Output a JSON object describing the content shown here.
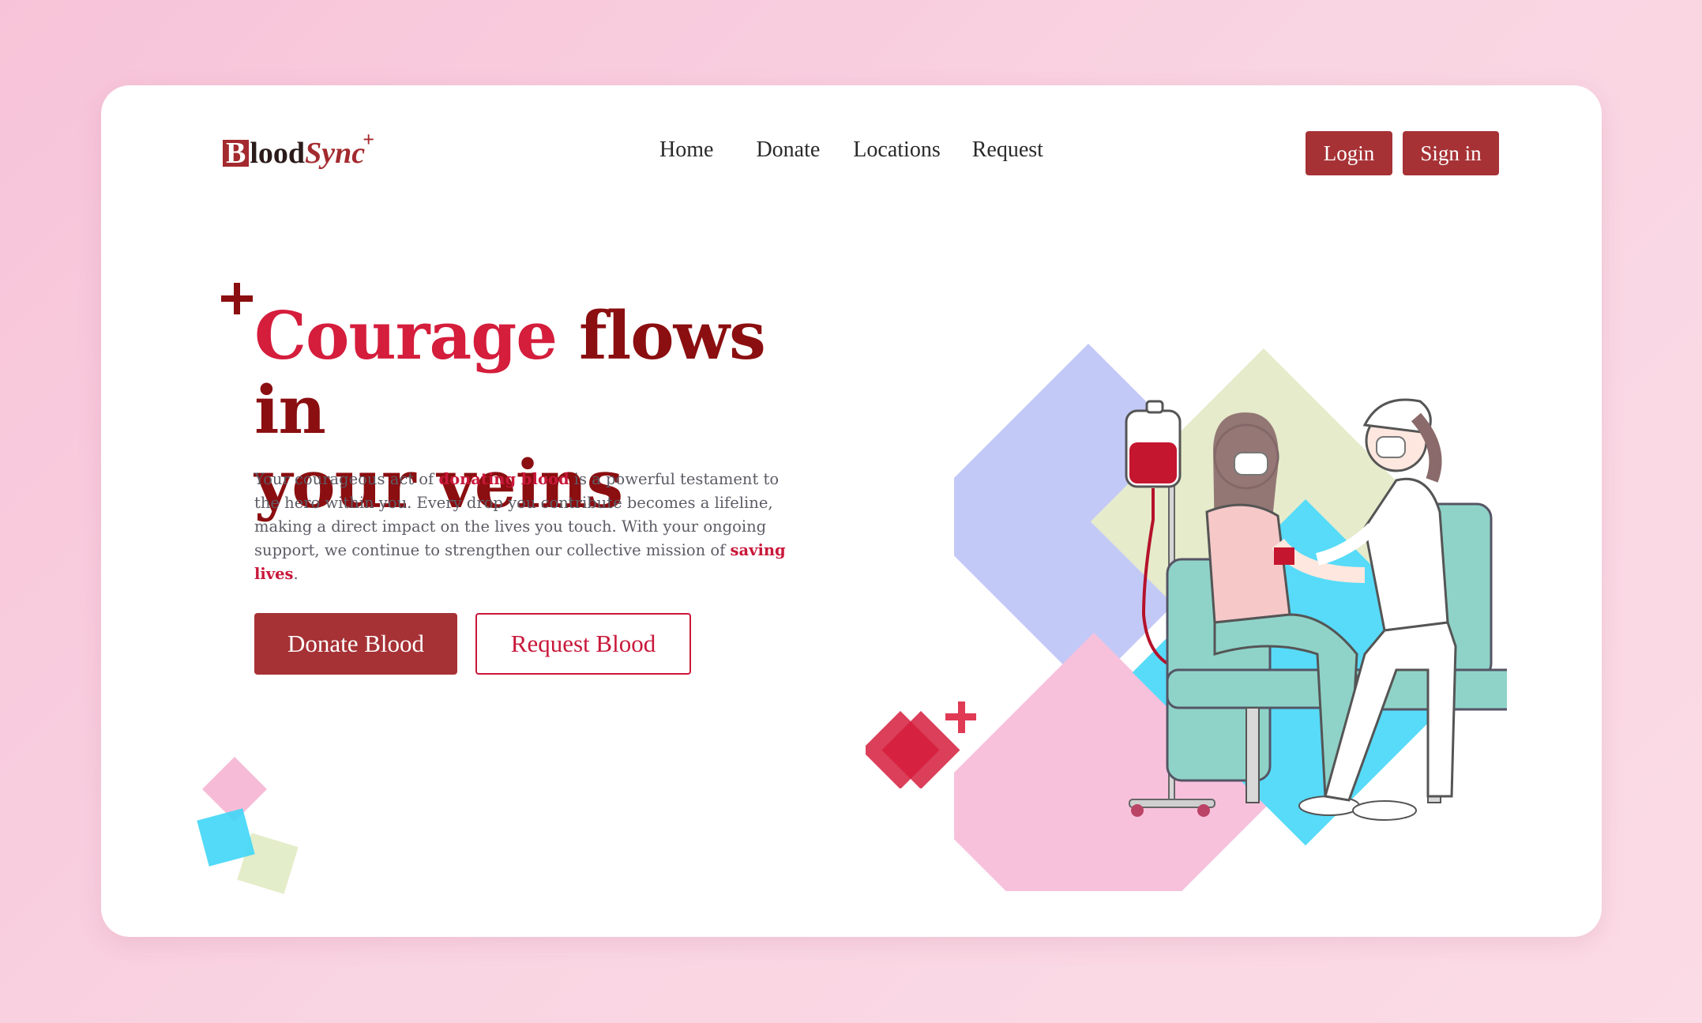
{
  "brand": {
    "logo_first_letter": "B",
    "logo_rest": "lood",
    "logo_sync": "Sync",
    "logo_plus": "+"
  },
  "nav": {
    "items": [
      "Home",
      "Donate",
      "Locations",
      "Request"
    ]
  },
  "auth": {
    "login_label": "Login",
    "signin_label": "Sign in"
  },
  "hero": {
    "headline_accent": "Courage",
    "headline_rest_line1": " flows in",
    "headline_line2": "your veins",
    "paragraph": {
      "part1": "Your courageous act of ",
      "highlight1": "donating blood",
      "part2": " is a powerful testament to the hero within you. Every drop you contribute becomes a lifeline, making a direct impact on the lives you touch. With your ongoing support, we continue to strengthen our collective mission of ",
      "highlight2": "saving lives",
      "part3": "."
    },
    "primary_cta": "Donate Blood",
    "secondary_cta": "Request Blood"
  },
  "colors": {
    "brand_red": "#a63236",
    "accent_red": "#d51d3c",
    "dark_red": "#8b0e10",
    "background_pink": "#f9d4e2"
  }
}
